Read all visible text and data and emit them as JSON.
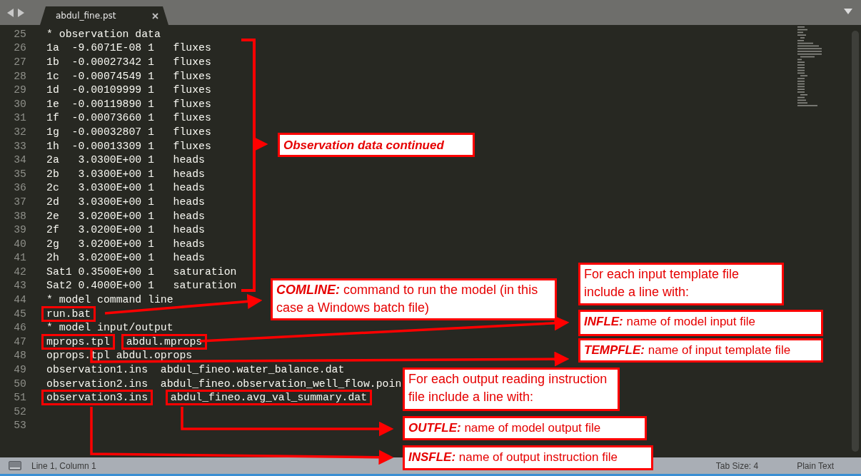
{
  "tab": {
    "title": "abdul_fine.pst",
    "selected": true
  },
  "lines": [
    {
      "number": "25",
      "text": "* observation data"
    },
    {
      "number": "26",
      "text": "1a  -9.6071E-08 1   fluxes"
    },
    {
      "number": "27",
      "text": "1b  -0.00027342 1   fluxes"
    },
    {
      "number": "28",
      "text": "1c  -0.00074549 1   fluxes"
    },
    {
      "number": "29",
      "text": "1d  -0.00109999 1   fluxes"
    },
    {
      "number": "30",
      "text": "1e  -0.00119890 1   fluxes"
    },
    {
      "number": "31",
      "text": "1f  -0.00073660 1   fluxes"
    },
    {
      "number": "32",
      "text": "1g  -0.00032807 1   fluxes"
    },
    {
      "number": "33",
      "text": "1h  -0.00013309 1   fluxes"
    },
    {
      "number": "34",
      "text": "2a   3.0300E+00 1   heads"
    },
    {
      "number": "35",
      "text": "2b   3.0300E+00 1   heads"
    },
    {
      "number": "36",
      "text": "2c   3.0300E+00 1   heads"
    },
    {
      "number": "37",
      "text": "2d   3.0300E+00 1   heads"
    },
    {
      "number": "38",
      "text": "2e   3.0200E+00 1   heads"
    },
    {
      "number": "39",
      "text": "2f   3.0200E+00 1   heads"
    },
    {
      "number": "40",
      "text": "2g   3.0200E+00 1   heads"
    },
    {
      "number": "41",
      "text": "2h   3.0200E+00 1   heads"
    },
    {
      "number": "42",
      "text": "Sat1 0.3500E+00 1   saturation"
    },
    {
      "number": "43",
      "text": "Sat2 0.4000E+00 1   saturation"
    },
    {
      "number": "44",
      "text": "* model command line"
    },
    {
      "number": "45",
      "text": "run.bat",
      "framed": true
    },
    {
      "number": "46",
      "text": "* model input/output"
    },
    {
      "number": "47",
      "text": "mprops.tpl abdul.mprops",
      "framed": true
    },
    {
      "number": "48",
      "text": "oprops.tpl abdul.oprops"
    },
    {
      "number": "49",
      "text": "observation1.ins  abdul_fineo.water_balance.dat"
    },
    {
      "number": "50",
      "text": "observation2.ins  abdul_fineo.observation_well_flow.poin"
    },
    {
      "number": "51",
      "text": "observation3.ins  abdul_fineo.avg_val_summary.dat",
      "framed": true
    },
    {
      "number": "52"
    },
    {
      "number": "53"
    }
  ],
  "callouts": [
    {
      "kind": "label",
      "label": "Observation data continued"
    },
    {
      "kind": "callout",
      "label": "COMLINE:",
      "text": " command to run the model (in this case a Windows batch file)"
    },
    {
      "kind": "note",
      "text": "For each input template file include a line with:"
    },
    {
      "kind": "callout",
      "label": "INFLE:",
      "text": " name of model input file"
    },
    {
      "kind": "callout",
      "label": "TEMPFLE:",
      "text": " name of input template file"
    },
    {
      "kind": "note",
      "text": "For each output reading instruction file include a line with:"
    },
    {
      "kind": "callout",
      "label": "OUTFLE:",
      "text": " name of model output file"
    },
    {
      "kind": "callout",
      "label": "INSFLE:",
      "text": " name of output instruction file"
    }
  ],
  "status_bar": {
    "position": "Line 1, Column 1",
    "tab_size": "Tab Size: 4",
    "syntax": "Plain Text"
  }
}
